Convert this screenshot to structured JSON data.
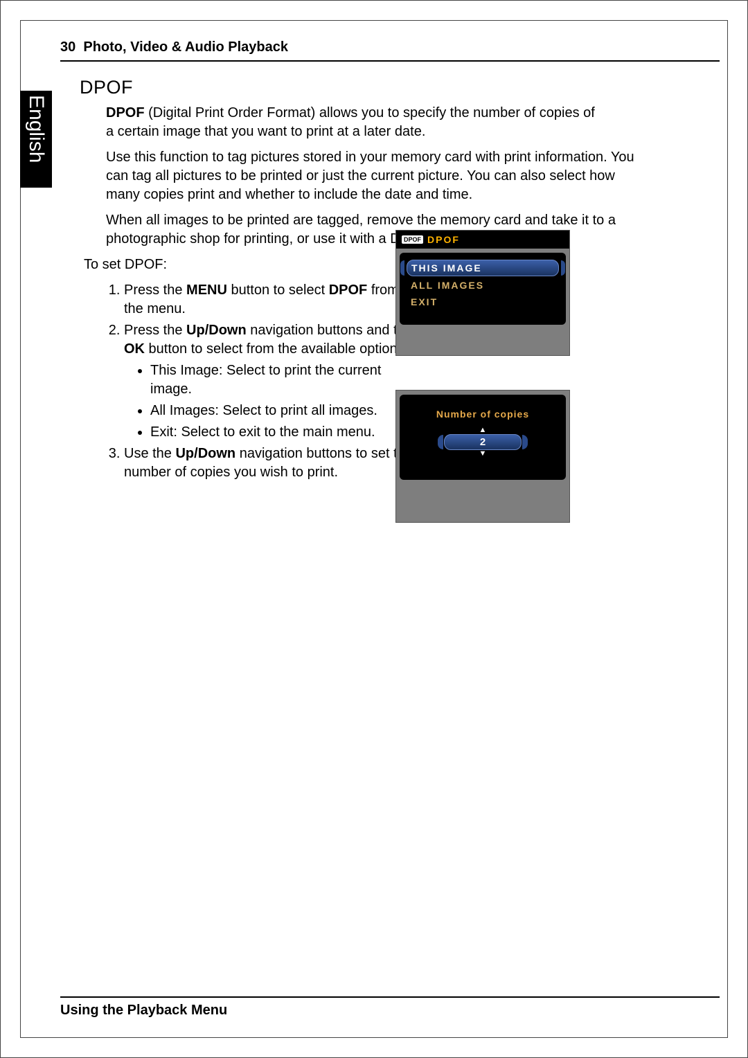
{
  "page_number": "30",
  "header_section": "Photo, Video & Audio Playback",
  "language_tab": "English",
  "title": "DPOF",
  "p1_lead": "DPOF",
  "p1_rest": " (Digital Print Order Format) allows you to specify the number of copies of a certain image that you want to print at a later date.",
  "p2": "Use this function to tag pictures stored in your memory card with print information. You can tag all pictures to be printed or just the current picture. You can also select how many copies print and whether to include the date and time.",
  "p3": "When all images to be printed are tagged, remove the memory card and take it to a photographic shop for printing, or use it with a DPOF compatible printer.",
  "p4": "To set DPOF:",
  "step1_a": "Press the ",
  "step1_menu": "MENU",
  "step1_b": " button to select ",
  "step1_dpof": "DPOF",
  "step1_c": " from the menu.",
  "step2_a": "Press the ",
  "step2_updown": "Up/Down",
  "step2_b": " navigation buttons and the ",
  "step2_ok": "OK",
  "step2_c": " button to select from the available options:",
  "opt1": "This Image: Select to print the current image.",
  "opt2": "All Images: Select to print all images.",
  "opt3": "Exit: Select to exit to the main menu.",
  "step3_a": "Use the ",
  "step3_updown": "Up/Down",
  "step3_b": " navigation buttons to set the number of copies you wish to print.",
  "lcd1": {
    "badge": "DPOF",
    "title": "DPOF",
    "items": [
      "THIS IMAGE",
      "ALL IMAGES",
      "EXIT"
    ]
  },
  "lcd2": {
    "label": "Number of copies",
    "value": "2"
  },
  "footer": "Using the Playback Menu"
}
